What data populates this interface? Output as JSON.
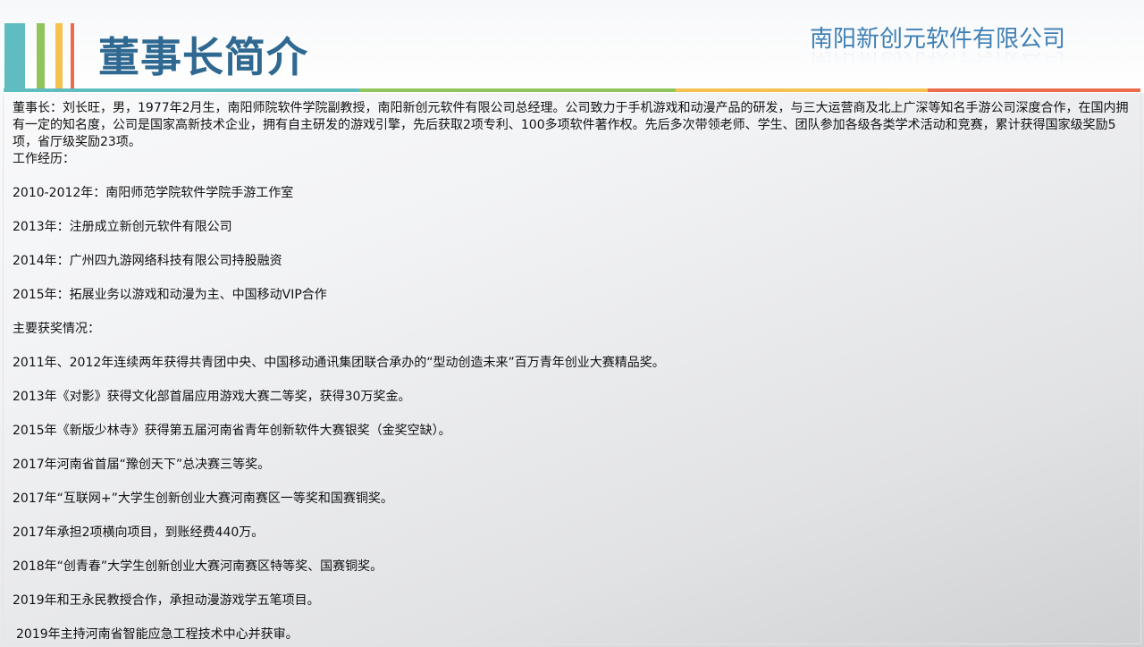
{
  "header": {
    "title": "董事长简介",
    "company": "南阳新创元软件有限公司"
  },
  "colors": {
    "teal": "#5fbcc0",
    "green": "#8fc55a",
    "yellow": "#f4c24e",
    "orange": "#ec6b4b",
    "title_blue": "#2f6890",
    "company_blue": "#3f80b5"
  },
  "content": {
    "intro": "董事长：刘长旺，男，1977年2月生，南阳师院软件学院副教授，南阳新创元软件有限公司总经理。公司致力于手机游戏和动漫产品的研发，与三大运营商及北上广深等知名手游公司深度合作，在国内拥有一定的知名度，公司是国家高新技术企业，拥有自主研发的游戏引擎，先后获取2项专利、100多项软件著作权。先后多次带领老师、学生、团队参加各级各类学术活动和竞赛，累计获得国家级奖励5项，省厅级奖励23项。",
    "work_heading": "工作经历：",
    "work": [
      "2010-2012年：南阳师范学院软件学院手游工作室",
      "2013年：注册成立新创元软件有限公司",
      "2014年：广州四九游网络科技有限公司持股融资",
      "2015年：拓展业务以游戏和动漫为主、中国移动VIP合作"
    ],
    "awards_heading": "主要获奖情况：",
    "awards": [
      "2011年、2012年连续两年获得共青团中央、中国移动通讯集团联合承办的“型动创造未来”百万青年创业大赛精品奖。",
      "2013年《对影》获得文化部首届应用游戏大赛二等奖，获得30万奖金。",
      "2015年《新版少林寺》获得第五届河南省青年创新软件大赛银奖（金奖空缺）。",
      "2017年河南省首届“豫创天下”总决赛三等奖。",
      "2017年“互联网+”大学生创新创业大赛河南赛区一等奖和国赛铜奖。",
      "2017年承担2项横向项目，到账经费440万。",
      "2018年“创青春”大学生创新创业大赛河南赛区特等奖、国赛铜奖。",
      "2019年和王永民教授合作，承担动漫游戏学五笔项目。",
      "2019年主持河南省智能应急工程技术中心并获审。"
    ]
  }
}
